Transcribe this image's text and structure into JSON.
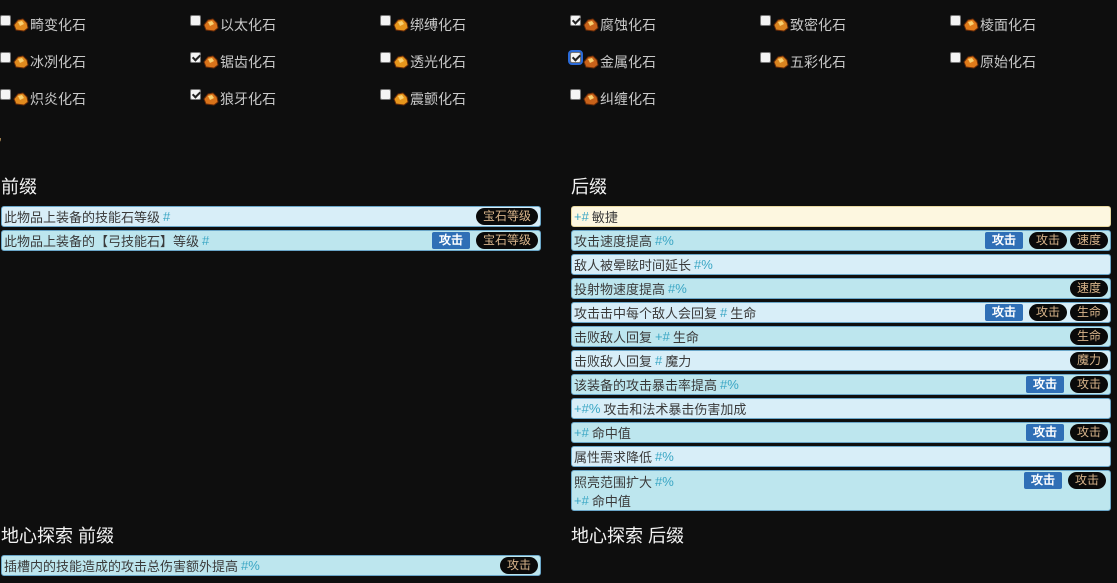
{
  "fossils": [
    {
      "name": "畸变化石",
      "checked": false,
      "icon": "fossil-aberrant-icon"
    },
    {
      "name": "以太化石",
      "checked": false,
      "icon": "fossil-aetheric-icon"
    },
    {
      "name": "绑缚化石",
      "checked": false,
      "icon": "fossil-bound-icon"
    },
    {
      "name": "腐蚀化石",
      "checked": true,
      "icon": "fossil-corroded-icon"
    },
    {
      "name": "致密化石",
      "checked": false,
      "icon": "fossil-dense-icon"
    },
    {
      "name": "棱面化石",
      "checked": false,
      "icon": "fossil-faceted-icon"
    },
    {
      "name": "冰冽化石",
      "checked": false,
      "icon": "fossil-frigid-icon"
    },
    {
      "name": "锯齿化石",
      "checked": true,
      "icon": "fossil-jagged-icon"
    },
    {
      "name": "透光化石",
      "checked": false,
      "icon": "fossil-lucent-icon"
    },
    {
      "name": "金属化石",
      "checked": true,
      "icon": "fossil-metallic-icon"
    },
    {
      "name": "五彩化石",
      "checked": false,
      "icon": "fossil-prismatic-icon"
    },
    {
      "name": "原始化石",
      "checked": false,
      "icon": "fossil-pristine-icon"
    },
    {
      "name": "炽炎化石",
      "checked": false,
      "icon": "fossil-scorched-icon"
    },
    {
      "name": "狼牙化石",
      "checked": true,
      "icon": "fossil-serrated-icon"
    },
    {
      "name": "震颤化石",
      "checked": false,
      "icon": "fossil-shuddering-icon"
    },
    {
      "name": "纠缠化石",
      "checked": false,
      "icon": "fossil-tangled-icon"
    }
  ],
  "stray_glyph": "”",
  "sections": {
    "prefix_title": "前缀",
    "suffix_title": "后缀",
    "delve_prefix_title": "地心探索 前缀",
    "delve_suffix_title": "地心探索 后缀"
  },
  "prefix_mods": [
    {
      "text": "此物品上装备的技能石等级",
      "tail": "#",
      "tags": [
        "宝石等级"
      ],
      "blue": []
    },
    {
      "text": "此物品上装备的【弓技能石】等级",
      "tail": "#",
      "tags": [
        "宝石等级"
      ],
      "blue": [
        "攻击"
      ]
    }
  ],
  "suffix_mods": [
    {
      "pre": "+#",
      "text": "敏捷",
      "tags": [],
      "blue": []
    },
    {
      "text": "攻击速度提高",
      "tail": "#%",
      "tags": [
        "攻击",
        "速度"
      ],
      "blue": [
        "攻击"
      ]
    },
    {
      "text": "敌人被晕眩时间延长",
      "tail": "#%",
      "tags": [],
      "blue": []
    },
    {
      "text": "投射物速度提高",
      "tail": "#%",
      "tags": [
        "速度"
      ],
      "blue": []
    },
    {
      "text": "攻击击中每个敌人会回复",
      "tail": "# 生命",
      "tags": [
        "攻击",
        "生命"
      ],
      "blue": [
        "攻击"
      ]
    },
    {
      "text": "击败敌人回复",
      "tail": "+# 生命",
      "tags": [
        "生命"
      ],
      "blue": []
    },
    {
      "text": "击败敌人回复",
      "tail": "# 魔力",
      "tags": [
        "魔力"
      ],
      "blue": []
    },
    {
      "text": "该装备的攻击暴击率提高",
      "tail": "#%",
      "tags": [
        "攻击"
      ],
      "blue": [
        "攻击"
      ]
    },
    {
      "pre": "+#%",
      "text": "攻击和法术暴击伤害加成",
      "tags": [],
      "blue": []
    },
    {
      "pre": "+#",
      "text": "命中值",
      "tags": [
        "攻击"
      ],
      "blue": [
        "攻击"
      ]
    },
    {
      "text": "属性需求降低",
      "tail": "#%",
      "tags": [],
      "blue": []
    },
    {
      "text": "照亮范围扩大",
      "tail": "#%",
      "line2_pre": "+#",
      "line2": "命中值",
      "tags": [
        "攻击"
      ],
      "blue": [
        "攻击"
      ]
    }
  ],
  "delve_prefix_mods": [
    {
      "text": "插槽内的技能造成的攻击总伤害额外提高",
      "tail": "#%",
      "tags": [
        "攻击"
      ],
      "blue": []
    }
  ]
}
